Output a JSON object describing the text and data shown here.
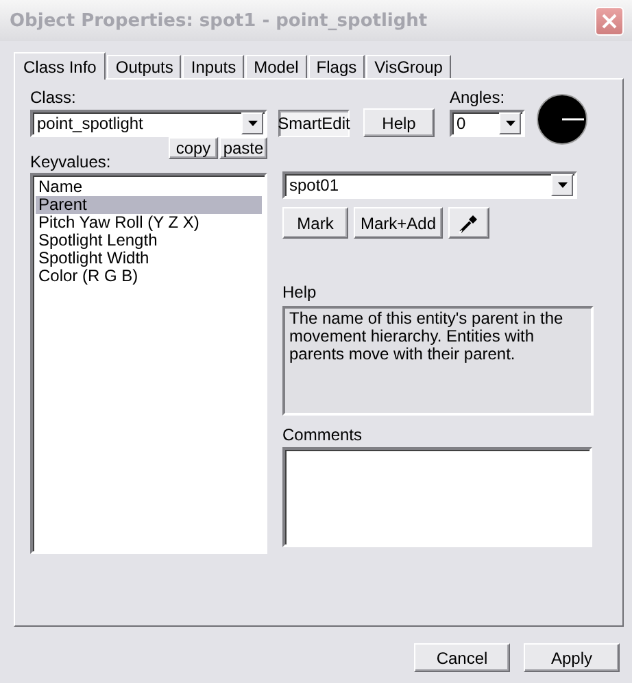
{
  "window": {
    "title": "Object Properties: spot1 - point_spotlight"
  },
  "tabs": [
    {
      "label": "Class Info",
      "selected": true
    },
    {
      "label": "Outputs",
      "selected": false
    },
    {
      "label": "Inputs",
      "selected": false
    },
    {
      "label": "Model",
      "selected": false
    },
    {
      "label": "Flags",
      "selected": false
    },
    {
      "label": "VisGroup",
      "selected": false
    }
  ],
  "class_field": {
    "label": "Class:",
    "value": "point_spotlight"
  },
  "smartedit_button": {
    "label": "SmartEdit",
    "on": true
  },
  "help_button": {
    "label": "Help"
  },
  "angles": {
    "label": "Angles:",
    "value": "0"
  },
  "keyvalues": {
    "label": "Keyvalues:",
    "copy": "copy",
    "paste": "paste",
    "items": [
      {
        "label": "Name",
        "selected": false
      },
      {
        "label": "Parent",
        "selected": true
      },
      {
        "label": "Pitch Yaw Roll (Y Z X)",
        "selected": false
      },
      {
        "label": "Spotlight Length",
        "selected": false
      },
      {
        "label": "Spotlight Width",
        "selected": false
      },
      {
        "label": "Color (R G B)",
        "selected": false
      }
    ]
  },
  "value_field": {
    "value": "spot01"
  },
  "mark_buttons": [
    "Mark",
    "Mark+Add"
  ],
  "help": {
    "label": "Help",
    "text": "The name of this entity's parent in the movement hierarchy. Entities with parents move with their parent."
  },
  "comments": {
    "label": "Comments"
  },
  "buttons": [
    "Cancel",
    "Apply"
  ]
}
